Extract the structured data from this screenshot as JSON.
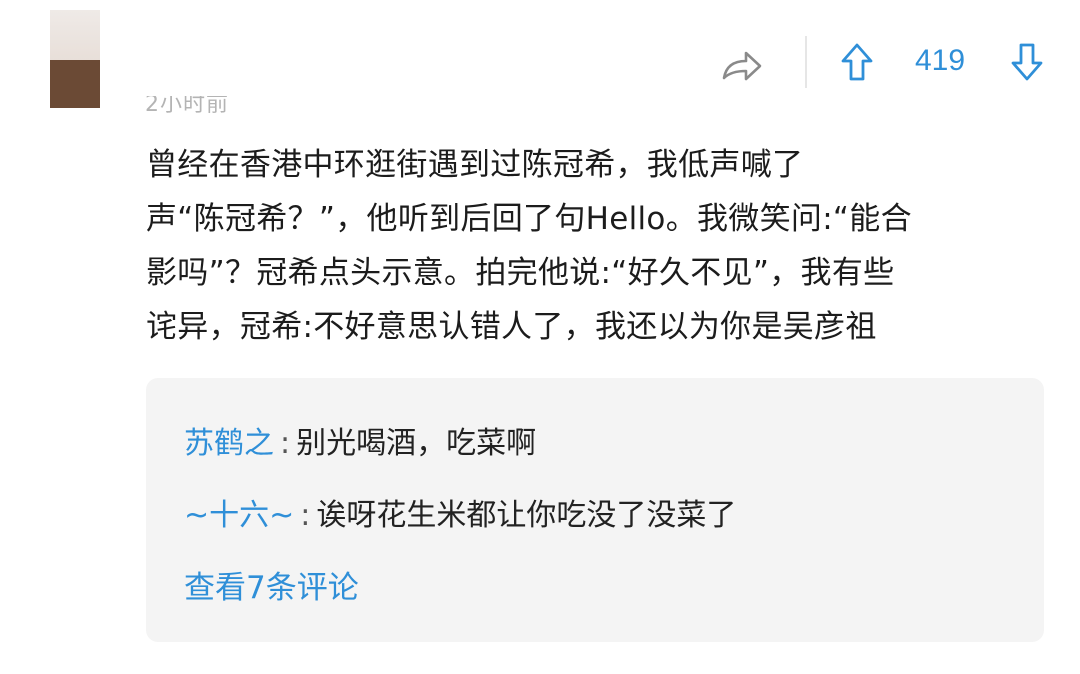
{
  "comment": {
    "timestamp": "2小时前",
    "text": "曾经在香港中环逛街遇到过陈冠希，我低声喊了\n声“陈冠希？”，他听到后回了句Hello。我微笑问:“能合\n影吗”？冠希点头示意。拍完他说:“好久不见”，我有些\n诧异，冠希:不好意思认错人了，我还以为你是吴彦祖",
    "vote_count": "419",
    "icons": {
      "share": "share-arrow-icon",
      "upvote": "arrow-up-icon",
      "downvote": "arrow-down-icon"
    }
  },
  "replies": [
    {
      "author": "苏鹤之",
      "separator": ":",
      "text": "别光喝酒，吃菜啊"
    },
    {
      "author": "~十六~",
      "separator": ":",
      "text": "诶呀花生米都让你吃没了没菜了"
    }
  ],
  "view_more_label": "查看7条评论",
  "colors": {
    "accent": "#2f8fd8",
    "text": "#1c1c1c",
    "muted": "#b4b4b4",
    "reply_background": "#f4f4f4"
  }
}
